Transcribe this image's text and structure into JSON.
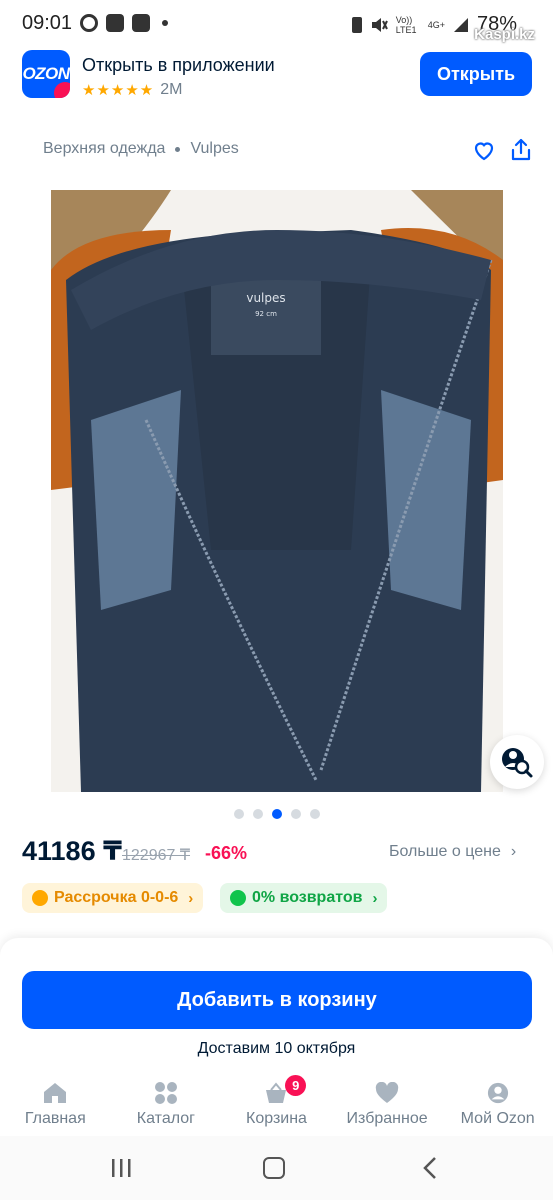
{
  "status_bar": {
    "time": "09:01",
    "network": "Vo)) LTE1",
    "net_type": "4G+",
    "battery": "78%",
    "watermark": "Kaspi.kz"
  },
  "app_banner": {
    "title": "Открыть в приложении",
    "rating_count": "2M",
    "stars": "★★★★★",
    "open_label": "Открыть",
    "logo_text": "OZON"
  },
  "breadcrumb": {
    "category": "Верхняя одежда",
    "brand": "Vulpes"
  },
  "product": {
    "label_brand": "vulpes",
    "label_size": "92 cm"
  },
  "gallery": {
    "total": 5,
    "active_index": 2
  },
  "price": {
    "current": "41186 ₸",
    "old": "122967 ₸",
    "discount": "-66%",
    "less_price_label": "Больше о цене"
  },
  "chips": {
    "installment": "Рассрочка 0-0-6",
    "returns": "0% возвратов"
  },
  "cart": {
    "add_label": "Добавить в корзину",
    "delivery": "Доставим 10 октября"
  },
  "tabbar": {
    "items": [
      {
        "label": "Главная",
        "icon": "home-icon"
      },
      {
        "label": "Каталог",
        "icon": "catalog-icon"
      },
      {
        "label": "Корзина",
        "icon": "cart-icon",
        "badge": "9"
      },
      {
        "label": "Избранное",
        "icon": "heart-icon"
      },
      {
        "label": "Мой Ozon",
        "icon": "profile-icon"
      }
    ]
  },
  "colors": {
    "accent": "#005bff",
    "discount": "#f91155",
    "installment": "#ffa800",
    "returns": "#10c44c"
  }
}
